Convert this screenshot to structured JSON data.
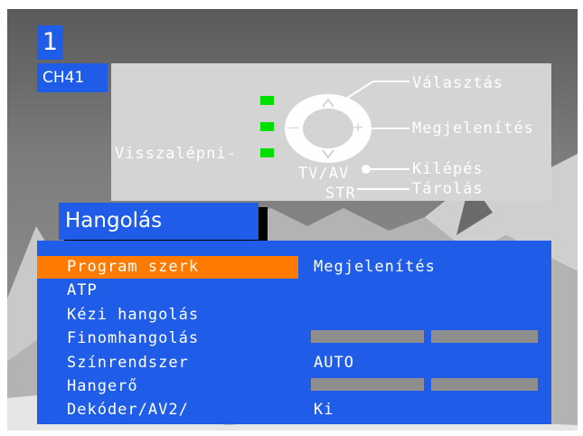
{
  "program": {
    "number": "1",
    "channel": "CH41"
  },
  "help": {
    "back_label": "Visszalépni-",
    "select_label": "Választás",
    "display_label": "Megjelenítés",
    "exit_label": "Kilépés",
    "store_label": "Tárolás",
    "tv_av_key": "TV/AV",
    "str_key": "STR",
    "minus_key": "–",
    "plus_key": "+"
  },
  "menu": {
    "title": "Hangolás",
    "items": [
      {
        "label": "Program szerk",
        "value": "Megjelenítés",
        "selected": true
      },
      {
        "label": "ATP",
        "value": ""
      },
      {
        "label": "Kézi hangolás",
        "value": ""
      },
      {
        "label": "Finomhangolás",
        "value": ""
      },
      {
        "label": "Színrendszer",
        "value": "AUTO"
      },
      {
        "label": "Hangerő",
        "value": ""
      },
      {
        "label": "Dekóder/AV2/",
        "value": "Ki"
      }
    ]
  },
  "colors": {
    "osd_blue": "#1f5de8",
    "highlight": "#ff7a00",
    "indicator_green": "#00e000",
    "help_gray": "#d4d4d4"
  }
}
